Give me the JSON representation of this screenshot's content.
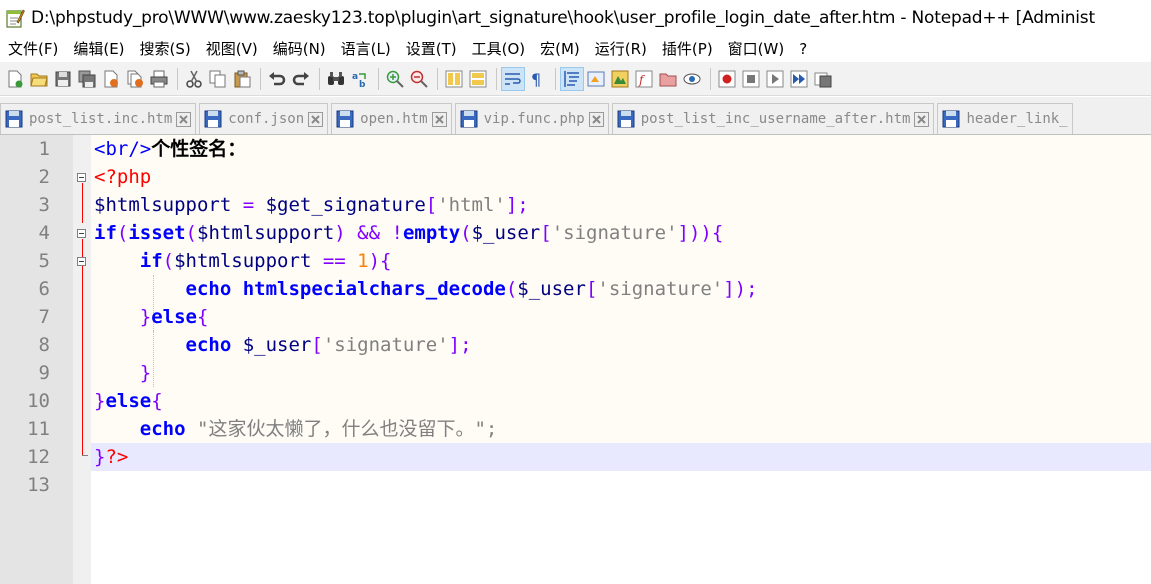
{
  "window": {
    "title": "D:\\phpstudy_pro\\WWW\\www.zaesky123.top\\plugin\\art_signature\\hook\\user_profile_login_date_after.htm - Notepad++ [Administ",
    "app_icon": "notepad-icon"
  },
  "menu": {
    "items": [
      "文件(F)",
      "编辑(E)",
      "搜索(S)",
      "视图(V)",
      "编码(N)",
      "语言(L)",
      "设置(T)",
      "工具(O)",
      "宏(M)",
      "运行(R)",
      "插件(P)",
      "窗口(W)",
      "?"
    ]
  },
  "toolbar": {
    "buttons": [
      "new-file-icon",
      "open-file-icon",
      "save-icon",
      "save-all-icon",
      "close-icon",
      "close-all-icon",
      "print-icon",
      "cut-icon",
      "copy-icon",
      "paste-icon",
      "undo-icon",
      "redo-icon",
      "find-icon",
      "replace-icon",
      "zoom-in-icon",
      "zoom-out-icon",
      "sync-vertical-icon",
      "sync-horizontal-icon",
      "word-wrap-icon",
      "show-all-chars-icon",
      "indent-guide-icon",
      "udl-icon",
      "doc-map-icon",
      "function-list-icon",
      "folder-as-workspace-icon",
      "monitoring-icon",
      "record-macro-icon",
      "stop-record-icon",
      "play-macro-icon",
      "run-macro-multiple-icon",
      "save-macro-icon"
    ]
  },
  "tabs": [
    {
      "label": "post_list.inc.htm"
    },
    {
      "label": "conf.json"
    },
    {
      "label": "open.htm"
    },
    {
      "label": "vip.func.php"
    },
    {
      "label": "post_list_inc_username_after.htm"
    },
    {
      "label": "header_link_"
    }
  ],
  "editor": {
    "current_line": 12,
    "lines": [
      {
        "n": "1"
      },
      {
        "n": "2"
      },
      {
        "n": "3"
      },
      {
        "n": "4"
      },
      {
        "n": "5"
      },
      {
        "n": "6"
      },
      {
        "n": "7"
      },
      {
        "n": "8"
      },
      {
        "n": "9"
      },
      {
        "n": "10"
      },
      {
        "n": "11"
      },
      {
        "n": "12"
      },
      {
        "n": "13"
      }
    ],
    "code": {
      "l1_tag": "<br/>",
      "l1_text": "个性签名：",
      "l2_open": "<?php",
      "l3_var": "$htmlsupport",
      "l3_eq": " = ",
      "l3_var2": "$get_signature",
      "l3_b1": "[",
      "l3_str": "'html'",
      "l3_b2": "];",
      "l4_if": "if",
      "l4_p1": "(",
      "l4_isset": "isset",
      "l4_p2": "(",
      "l4_var": "$htmlsupport",
      "l4_p3": ") ",
      "l4_and": "&&",
      "l4_sp": " !",
      "l4_empty": "empty",
      "l4_p4": "(",
      "l4_var2": "$_user",
      "l4_b1": "[",
      "l4_str": "'signature'",
      "l4_b2": "])){",
      "l5_if": "if",
      "l5_p1": "(",
      "l5_var": "$htmlsupport",
      "l5_eq": " == ",
      "l5_num": "1",
      "l5_p2": "){",
      "l6_echo": "echo",
      "l6_fn": "htmlspecialchars_decode",
      "l6_p1": "(",
      "l6_var": "$_user",
      "l6_b1": "[",
      "l6_str": "'signature'",
      "l6_b2": "]);",
      "l7_close": "}",
      "l7_else": "else",
      "l7_open": "{",
      "l8_echo": "echo",
      "l8_var": "$_user",
      "l8_b1": "[",
      "l8_str": "'signature'",
      "l8_b2": "];",
      "l9_close": "}",
      "l10_close": "}",
      "l10_else": "else",
      "l10_open": "{",
      "l11_echo": "echo",
      "l11_q1": "\"",
      "l11_str": "这家伙太懒了，什么也没留下。",
      "l11_q2": "\";",
      "l12_close": "}",
      "l12_end": "?>"
    }
  },
  "colors": {
    "tag": "#0000ff",
    "php_delim": "#ff0000",
    "keyword": "#0000ff",
    "string": "#808080",
    "number": "#ff8000",
    "operator": "#8000ff",
    "variable": "#000080",
    "current_line": "#e8e8ff",
    "gutter": "#e4e4e4"
  }
}
